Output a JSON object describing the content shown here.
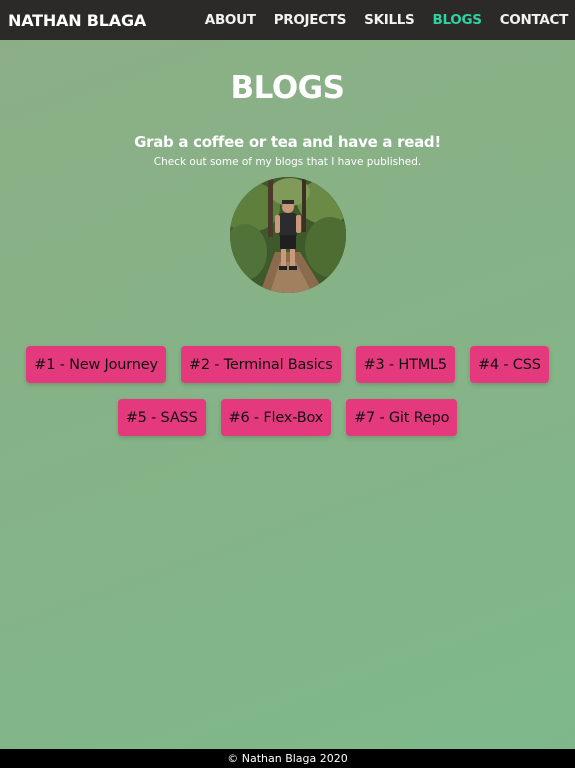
{
  "nav": {
    "brand": "NATHAN BLAGA",
    "links": [
      {
        "label": "ABOUT",
        "active": false
      },
      {
        "label": "PROJECTS",
        "active": false
      },
      {
        "label": "SKILLS",
        "active": false
      },
      {
        "label": "BLOGS",
        "active": true
      },
      {
        "label": "CONTACT",
        "active": false
      }
    ],
    "active_color": "#2ed3a0"
  },
  "main": {
    "title": "BLOGS",
    "subtitle": "Grab a coffee or tea and have a read!",
    "tagline": "Check out some of my blogs that I have published.",
    "blogs": [
      {
        "label": "#1 - New Journey"
      },
      {
        "label": "#2 - Terminal Basics"
      },
      {
        "label": "#3 - HTML5"
      },
      {
        "label": "#4 - CSS"
      },
      {
        "label": "#5 - SASS"
      },
      {
        "label": "#6 - Flex-Box"
      },
      {
        "label": "#7 - Git Repo"
      }
    ],
    "button_color": "#e5397e"
  },
  "footer": {
    "copyright": "© Nathan Blaga 2020"
  }
}
